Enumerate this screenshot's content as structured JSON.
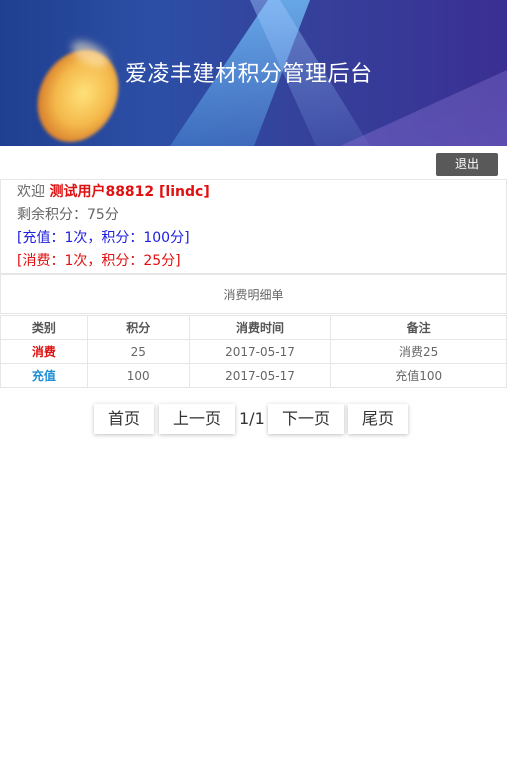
{
  "header": {
    "title": "爱凌丰建材积分管理后台"
  },
  "toolbar": {
    "logout_label": "退出"
  },
  "user_info": {
    "welcome_prefix": "欢迎",
    "user_name": "测试用户88812 [lindc]",
    "remaining_points": "剩余积分：75分",
    "recharge_summary": "[充值：1次，积分：100分]",
    "consume_summary": "[消费：1次，积分：25分]"
  },
  "detail": {
    "title": "消费明细单",
    "columns": [
      "类别",
      "积分",
      "消费时间",
      "备注"
    ],
    "rows": [
      {
        "type": "消费",
        "points": "25",
        "time": "2017-05-17",
        "note": "消费25",
        "color": "#e01010"
      },
      {
        "type": "充值",
        "points": "100",
        "time": "2017-05-17",
        "note": "充值100",
        "color": "#1e8fd6"
      }
    ]
  },
  "pager": {
    "first": "首页",
    "prev": "上一页",
    "page_info": "1/1",
    "next": "下一页",
    "last": "尾页"
  },
  "colors": {
    "banner": "#2c4fa6",
    "consume": "#e01010",
    "recharge": "#1e8fd6",
    "logout_bg": "#595959"
  }
}
